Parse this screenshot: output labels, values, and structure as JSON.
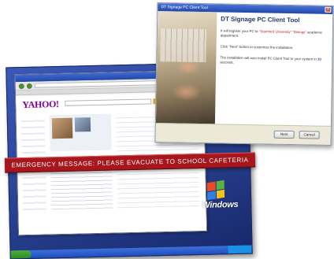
{
  "background_screen": {
    "browser": {
      "logo": "YAHOO!"
    },
    "desktop": {
      "os_logo_text": "Windows"
    }
  },
  "emergency_banner": {
    "message": "EMERGENCY MESSAGE: PLEASE EVACUATE TO SCHOOL CAFETERIA",
    "color": "#a6161c"
  },
  "dialog": {
    "window_title": "DT Signage PC Client Tool",
    "heading": "DT Signage PC Client Tool",
    "para1_prefix": "It will register your PC to ",
    "para1_highlight": "\"Stamford University\" \"Biology\"",
    "para1_suffix": " academic department.",
    "para2": "Click \"Next\" button to customize the installation.",
    "para3_prefix": "The installation will auto install PC Client Tool to your system in ",
    "para3_count": "10",
    "para3_suffix": " seconds.",
    "buttons": {
      "next": "Next",
      "cancel": "Cancel"
    },
    "accent_color": "#c0201f"
  }
}
